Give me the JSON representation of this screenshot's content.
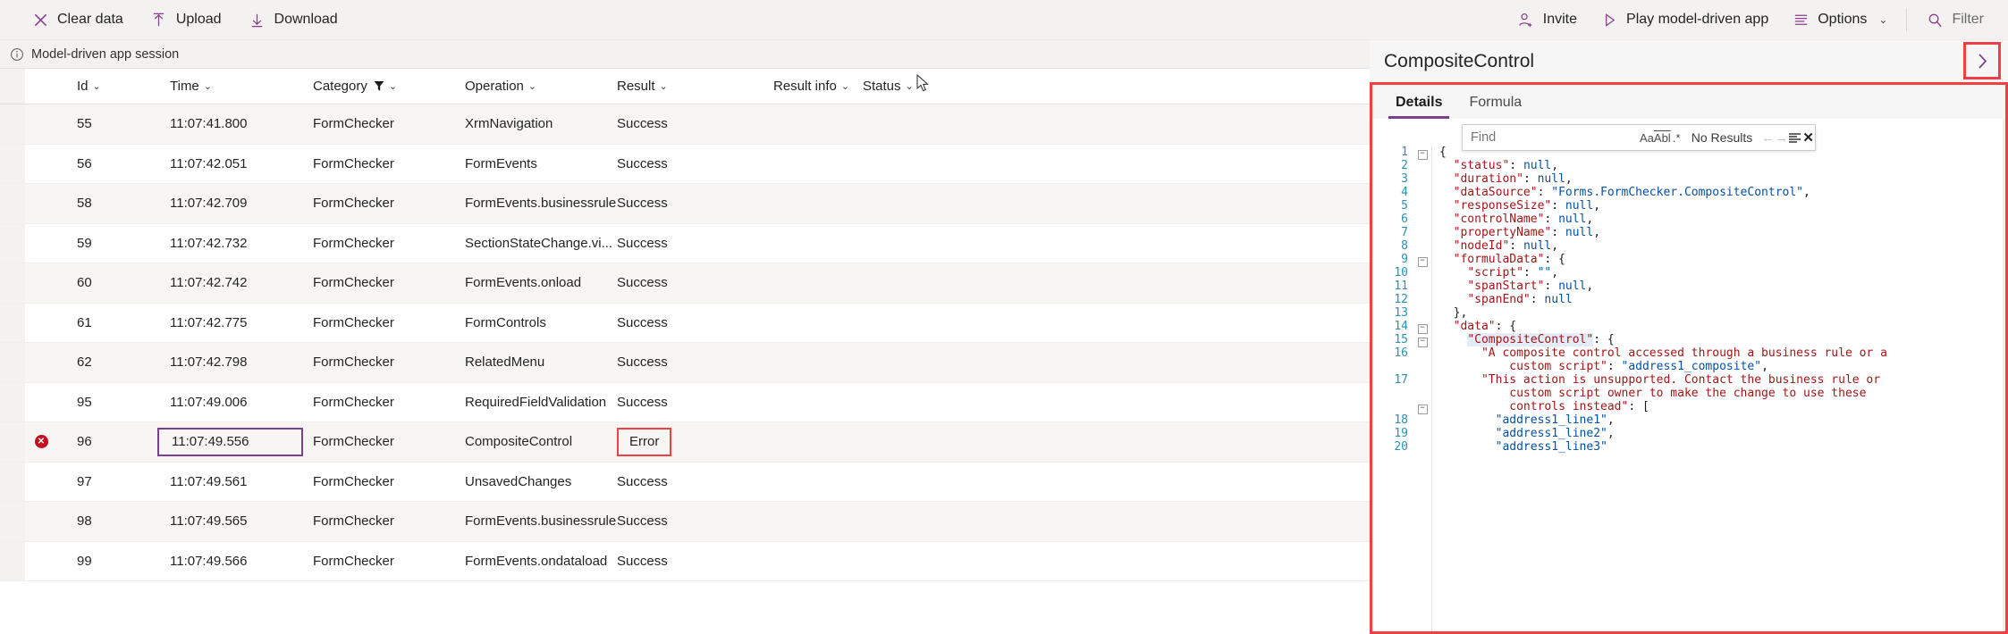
{
  "toolbar": {
    "left": [
      {
        "label": "Clear data",
        "icon": "close-icon"
      },
      {
        "label": "Upload",
        "icon": "upload-icon"
      },
      {
        "label": "Download",
        "icon": "download-icon"
      }
    ],
    "right": [
      {
        "label": "Invite",
        "icon": "add-user-icon"
      },
      {
        "label": "Play model-driven app",
        "icon": "play-icon"
      },
      {
        "label": "Options",
        "icon": "options-icon",
        "chevron": "⌄"
      },
      {
        "label": "Filter",
        "icon": "search-icon"
      }
    ]
  },
  "session": {
    "label": "Model-driven app session",
    "info_icon": "info-icon",
    "close_icon": "close-icon"
  },
  "table": {
    "columns": [
      {
        "label": "Id",
        "sort": "⌄"
      },
      {
        "label": "Time",
        "sort": "⌄"
      },
      {
        "label": "Category",
        "sort": "⌄",
        "filter": "funnel-icon"
      },
      {
        "label": "Operation",
        "sort": "⌄"
      },
      {
        "label": "Result",
        "sort": "⌄"
      },
      {
        "label": "Result info",
        "sort": "⌄"
      },
      {
        "label": "Status",
        "sort": "⌄"
      }
    ],
    "rows": [
      {
        "id": "55",
        "time": "11:07:41.800",
        "category": "FormChecker",
        "operation": "XrmNavigation",
        "result": "Success",
        "result_info": "",
        "status": "",
        "error": false
      },
      {
        "id": "56",
        "time": "11:07:42.051",
        "category": "FormChecker",
        "operation": "FormEvents",
        "result": "Success",
        "result_info": "",
        "status": "",
        "error": false
      },
      {
        "id": "58",
        "time": "11:07:42.709",
        "category": "FormChecker",
        "operation": "FormEvents.businessrule",
        "result": "Success",
        "result_info": "",
        "status": "",
        "error": false
      },
      {
        "id": "59",
        "time": "11:07:42.732",
        "category": "FormChecker",
        "operation": "SectionStateChange.vi...",
        "result": "Success",
        "result_info": "",
        "status": "",
        "error": false
      },
      {
        "id": "60",
        "time": "11:07:42.742",
        "category": "FormChecker",
        "operation": "FormEvents.onload",
        "result": "Success",
        "result_info": "",
        "status": "",
        "error": false
      },
      {
        "id": "61",
        "time": "11:07:42.775",
        "category": "FormChecker",
        "operation": "FormControls",
        "result": "Success",
        "result_info": "",
        "status": "",
        "error": false
      },
      {
        "id": "62",
        "time": "11:07:42.798",
        "category": "FormChecker",
        "operation": "RelatedMenu",
        "result": "Success",
        "result_info": "",
        "status": "",
        "error": false
      },
      {
        "id": "95",
        "time": "11:07:49.006",
        "category": "FormChecker",
        "operation": "RequiredFieldValidation",
        "result": "Success",
        "result_info": "",
        "status": "",
        "error": false
      },
      {
        "id": "96",
        "time": "11:07:49.556",
        "category": "FormChecker",
        "operation": "CompositeControl",
        "result": "Error",
        "result_info": "",
        "status": "",
        "error": true,
        "selected": true
      },
      {
        "id": "97",
        "time": "11:07:49.561",
        "category": "FormChecker",
        "operation": "UnsavedChanges",
        "result": "Success",
        "result_info": "",
        "status": "",
        "error": false
      },
      {
        "id": "98",
        "time": "11:07:49.565",
        "category": "FormChecker",
        "operation": "FormEvents.businessrule",
        "result": "Success",
        "result_info": "",
        "status": "",
        "error": false
      },
      {
        "id": "99",
        "time": "11:07:49.566",
        "category": "FormChecker",
        "operation": "FormEvents.ondataload",
        "result": "Success",
        "result_info": "",
        "status": "",
        "error": false
      }
    ]
  },
  "details": {
    "title": "CompositeControl",
    "expand_icon": "chevron-right-icon",
    "collapse_icon": "chevron-left-icon",
    "tabs": [
      {
        "label": "Details",
        "active": true
      },
      {
        "label": "Formula",
        "active": false
      }
    ],
    "find": {
      "placeholder": "Find",
      "value": "",
      "match_case_icon": "Aa",
      "match_word_icon": "Abl",
      "regex_icon": ".*",
      "status": "No Results",
      "prev_icon": "←",
      "next_icon": "→",
      "list_icon": "find-in-selection-icon",
      "close_icon": "✕"
    },
    "code_lines": [
      {
        "num": "1",
        "fold": true,
        "indent": 0,
        "tokens": [
          {
            "t": "{",
            "c": "p"
          }
        ]
      },
      {
        "num": "2",
        "fold": false,
        "indent": 1,
        "tokens": [
          {
            "t": "\"status\"",
            "c": "k"
          },
          {
            "t": ": ",
            "c": "p"
          },
          {
            "t": "null",
            "c": "v"
          },
          {
            "t": ",",
            "c": "p"
          }
        ]
      },
      {
        "num": "3",
        "fold": false,
        "indent": 1,
        "tokens": [
          {
            "t": "\"duration\"",
            "c": "k"
          },
          {
            "t": ": ",
            "c": "p"
          },
          {
            "t": "null",
            "c": "v"
          },
          {
            "t": ",",
            "c": "p"
          }
        ]
      },
      {
        "num": "4",
        "fold": false,
        "indent": 1,
        "tokens": [
          {
            "t": "\"dataSource\"",
            "c": "k"
          },
          {
            "t": ": ",
            "c": "p"
          },
          {
            "t": "\"Forms.FormChecker.CompositeControl\"",
            "c": "v"
          },
          {
            "t": ",",
            "c": "p"
          }
        ]
      },
      {
        "num": "5",
        "fold": false,
        "indent": 1,
        "tokens": [
          {
            "t": "\"responseSize\"",
            "c": "k"
          },
          {
            "t": ": ",
            "c": "p"
          },
          {
            "t": "null",
            "c": "v"
          },
          {
            "t": ",",
            "c": "p"
          }
        ]
      },
      {
        "num": "6",
        "fold": false,
        "indent": 1,
        "tokens": [
          {
            "t": "\"controlName\"",
            "c": "k"
          },
          {
            "t": ": ",
            "c": "p"
          },
          {
            "t": "null",
            "c": "v"
          },
          {
            "t": ",",
            "c": "p"
          }
        ]
      },
      {
        "num": "7",
        "fold": false,
        "indent": 1,
        "tokens": [
          {
            "t": "\"propertyName\"",
            "c": "k"
          },
          {
            "t": ": ",
            "c": "p"
          },
          {
            "t": "null",
            "c": "v"
          },
          {
            "t": ",",
            "c": "p"
          }
        ]
      },
      {
        "num": "8",
        "fold": false,
        "indent": 1,
        "tokens": [
          {
            "t": "\"nodeId\"",
            "c": "k"
          },
          {
            "t": ": ",
            "c": "p"
          },
          {
            "t": "null",
            "c": "v"
          },
          {
            "t": ",",
            "c": "p"
          }
        ]
      },
      {
        "num": "9",
        "fold": true,
        "indent": 1,
        "tokens": [
          {
            "t": "\"formulaData\"",
            "c": "k"
          },
          {
            "t": ": {",
            "c": "p"
          }
        ]
      },
      {
        "num": "10",
        "fold": false,
        "indent": 2,
        "tokens": [
          {
            "t": "\"script\"",
            "c": "k"
          },
          {
            "t": ": ",
            "c": "p"
          },
          {
            "t": "\"\"",
            "c": "v"
          },
          {
            "t": ",",
            "c": "p"
          }
        ]
      },
      {
        "num": "11",
        "fold": false,
        "indent": 2,
        "tokens": [
          {
            "t": "\"spanStart\"",
            "c": "k"
          },
          {
            "t": ": ",
            "c": "p"
          },
          {
            "t": "null",
            "c": "v"
          },
          {
            "t": ",",
            "c": "p"
          }
        ]
      },
      {
        "num": "12",
        "fold": false,
        "indent": 2,
        "tokens": [
          {
            "t": "\"spanEnd\"",
            "c": "k"
          },
          {
            "t": ": ",
            "c": "p"
          },
          {
            "t": "null",
            "c": "v"
          }
        ]
      },
      {
        "num": "13",
        "fold": false,
        "indent": 1,
        "tokens": [
          {
            "t": "},",
            "c": "p"
          }
        ]
      },
      {
        "num": "14",
        "fold": true,
        "indent": 1,
        "tokens": [
          {
            "t": "\"data\"",
            "c": "k"
          },
          {
            "t": ": {",
            "c": "p"
          }
        ]
      },
      {
        "num": "15",
        "fold": true,
        "indent": 2,
        "tokens": [
          {
            "t": "\"CompositeControl\"",
            "c": "k hl"
          },
          {
            "t": ": {",
            "c": "p"
          }
        ]
      },
      {
        "num": "16",
        "fold": false,
        "indent": 3,
        "tokens": [
          {
            "t": "\"A composite control accessed through a business rule or a",
            "c": "k"
          }
        ]
      },
      {
        "num": "",
        "fold": false,
        "indent": 5,
        "tokens": [
          {
            "t": "custom script\"",
            "c": "k"
          },
          {
            "t": ": ",
            "c": "p"
          },
          {
            "t": "\"address1_composite\"",
            "c": "v"
          },
          {
            "t": ",",
            "c": "p"
          }
        ]
      },
      {
        "num": "17",
        "fold": false,
        "indent": 3,
        "tokens": [
          {
            "t": "\"This action is unsupported. Contact the business rule or",
            "c": "k"
          }
        ]
      },
      {
        "num": "",
        "fold": false,
        "indent": 5,
        "tokens": [
          {
            "t": "custom script owner to make the change to use these",
            "c": "k"
          }
        ]
      },
      {
        "num": "",
        "fold": true,
        "indent": 5,
        "tokens": [
          {
            "t": "controls instead\"",
            "c": "k"
          },
          {
            "t": ": [",
            "c": "p"
          }
        ]
      },
      {
        "num": "18",
        "fold": false,
        "indent": 4,
        "tokens": [
          {
            "t": "\"address1_line1\"",
            "c": "v"
          },
          {
            "t": ",",
            "c": "p"
          }
        ]
      },
      {
        "num": "19",
        "fold": false,
        "indent": 4,
        "tokens": [
          {
            "t": "\"address1_line2\"",
            "c": "v"
          },
          {
            "t": ",",
            "c": "p"
          }
        ]
      },
      {
        "num": "20",
        "fold": false,
        "indent": 4,
        "tokens": [
          {
            "t": "\"address1_line3\"",
            "c": "v"
          }
        ]
      }
    ]
  },
  "colors": {
    "accent": "#7b3f8f",
    "error": "#c50f1f",
    "highlight_box": "#f23f42",
    "chrome": "#f3f2f1"
  }
}
